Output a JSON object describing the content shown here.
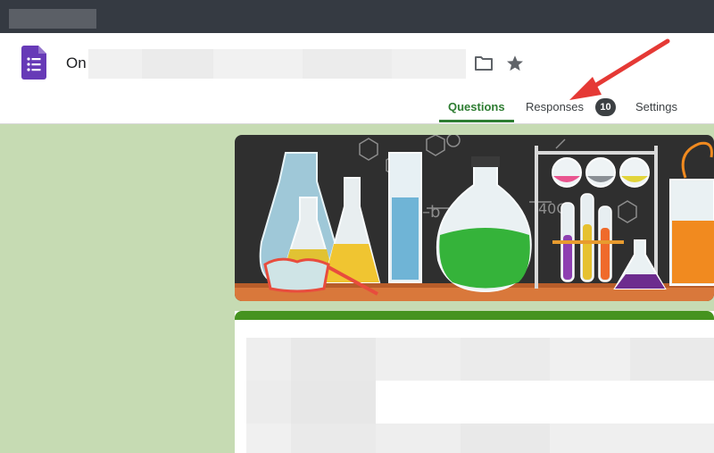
{
  "browser": {
    "tab_strip_blurred": true
  },
  "header": {
    "app_icon": "google-forms-icon",
    "title_visible": "On",
    "title_redacted": true,
    "folder_icon": "folder-icon",
    "star_icon": "star-icon"
  },
  "tabs": [
    {
      "label": "Questions",
      "active": true
    },
    {
      "label": "Responses",
      "badge": "10",
      "active": false
    },
    {
      "label": "Settings",
      "active": false
    }
  ],
  "annotation": {
    "type": "arrow",
    "color": "#e53935",
    "points_to": "Responses"
  },
  "banner": {
    "theme": "science-lab-glassware"
  },
  "colors": {
    "accent": "#2e7d32",
    "theme_green": "#45931f",
    "page_background": "#c6dbb3",
    "forms_purple": "#673ab7"
  }
}
